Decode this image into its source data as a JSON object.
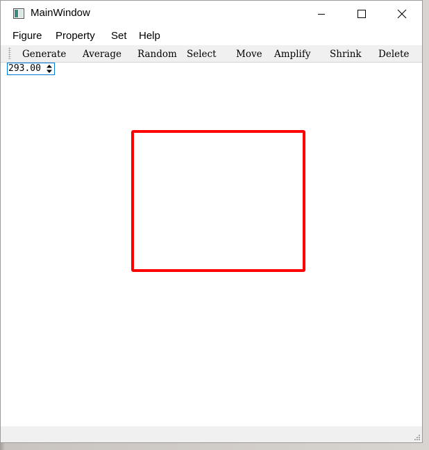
{
  "window": {
    "title": "MainWindow"
  },
  "menubar": {
    "items": [
      {
        "label": "Figure"
      },
      {
        "label": "Property"
      },
      {
        "label": "Set"
      },
      {
        "label": "Help"
      }
    ]
  },
  "toolbar": {
    "buttons": [
      {
        "label": "Generate"
      },
      {
        "label": "Average"
      },
      {
        "label": "Random"
      },
      {
        "label": "Select"
      },
      {
        "label": "Move"
      },
      {
        "label": "Amplify"
      },
      {
        "label": "Shrink"
      },
      {
        "label": "Delete"
      }
    ]
  },
  "spinbox": {
    "value": "293.00"
  },
  "canvas": {
    "shape": "rectangle",
    "stroke_color": "#ff0000"
  },
  "icons": {
    "app": "window-app-icon",
    "minimize": "minimize-icon",
    "maximize": "maximize-icon",
    "close": "close-icon",
    "spin": "spin-arrows-icon",
    "grip": "size-grip-icon"
  }
}
